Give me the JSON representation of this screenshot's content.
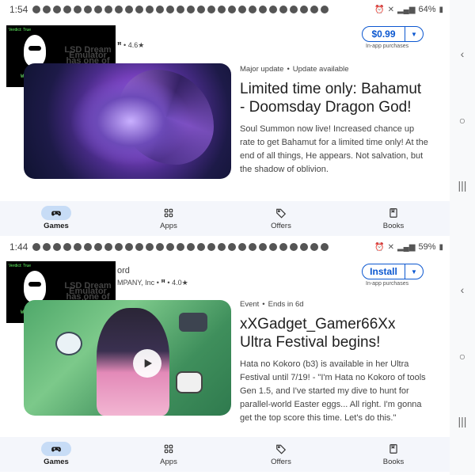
{
  "panel1": {
    "status": {
      "time": "1:54",
      "battery": "64%"
    },
    "overlay": {
      "verdict": "Verdict: True",
      "text": "LSD Dream Emulator has one of the strangest soundtracks of all videogames",
      "caption": "Well it's called LSD Dream simulator soo..."
    },
    "dev_rating": "4.6★",
    "price": {
      "label": "$0.99",
      "note": "In-app purchases"
    },
    "meta": {
      "left": "Major update",
      "right": "Update available"
    },
    "title": "Limited time only: Bahamut - Doomsday Dragon God!",
    "description": "Soul Summon now live! Increased chance up rate to get Bahamut for a limited time only! At the end of all things, He appears. Not salvation, but the shadow of oblivion."
  },
  "panel2": {
    "status": {
      "time": "1:44",
      "battery": "59%"
    },
    "overlay": {
      "verdict": "Verdict: True",
      "text": "LSD Dream Emulator has one of the strangest soundtracks of all videogames",
      "caption": "Well it's called LSD Dream simulator soo..."
    },
    "dev_partial": "ord",
    "dev_company": "MPANY, Inc",
    "dev_rating": "4.0★",
    "install": {
      "label": "Install",
      "note": "In-app purchases"
    },
    "meta": {
      "left": "Event",
      "right": "Ends in 6d"
    },
    "title": "xXGadget_Gamer66Xx Ultra Festival begins!",
    "description": "Hata no Kokoro (b3) is available in her Ultra Festival until 7/19! - \"I'm Hata no Kokoro of tools Gen 1.5, and I've started my dive to hunt for parallel-world Easter eggs... All right. I'm gonna get the top score this time. Let's do this.\""
  },
  "nav": {
    "games": "Games",
    "apps": "Apps",
    "offers": "Offers",
    "books": "Books"
  },
  "colors": {
    "accent": "#0b57d0",
    "nav_active": "#c7dcf6"
  }
}
